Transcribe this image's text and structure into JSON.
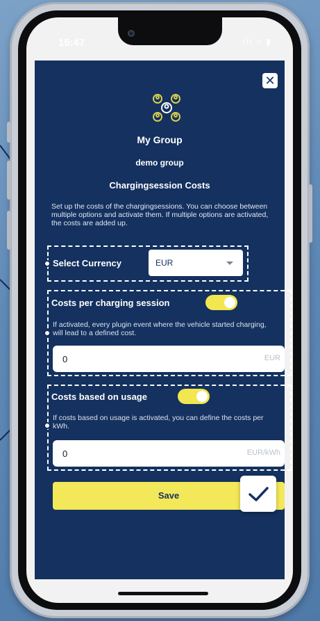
{
  "status": {
    "time": "15:47",
    "icons": "ıll ≈ ▮"
  },
  "modal": {
    "close_label": "✕",
    "group_name": "My Group",
    "group_sub": "demo group",
    "section_title": "Chargingsession Costs",
    "intro": "Set up the costs of the chargingsessions. You can choose between multiple options and activate them. If multiple options are activated, the costs are added up.",
    "currency": {
      "label": "Select Currency",
      "value": "EUR"
    },
    "per_session": {
      "label": "Costs per charging session",
      "enabled": true,
      "help": "If activated, every plugin event where the vehicle started charging, will lead to a defined cost.",
      "value": "0",
      "unit": "EUR"
    },
    "usage": {
      "label": "Costs based on usage",
      "enabled": true,
      "help": "If costs based on usage is activated, you can define the costs per kWh.",
      "value": "0",
      "unit": "EUR/kWh"
    },
    "save_label": "Save"
  },
  "colors": {
    "modal_bg": "#14315f",
    "accent_yellow": "#f3e859",
    "page_bg": "#6a92bd"
  },
  "icons": [
    "group-icon",
    "close-icon",
    "chevron-down-icon",
    "checkmark-icon"
  ]
}
